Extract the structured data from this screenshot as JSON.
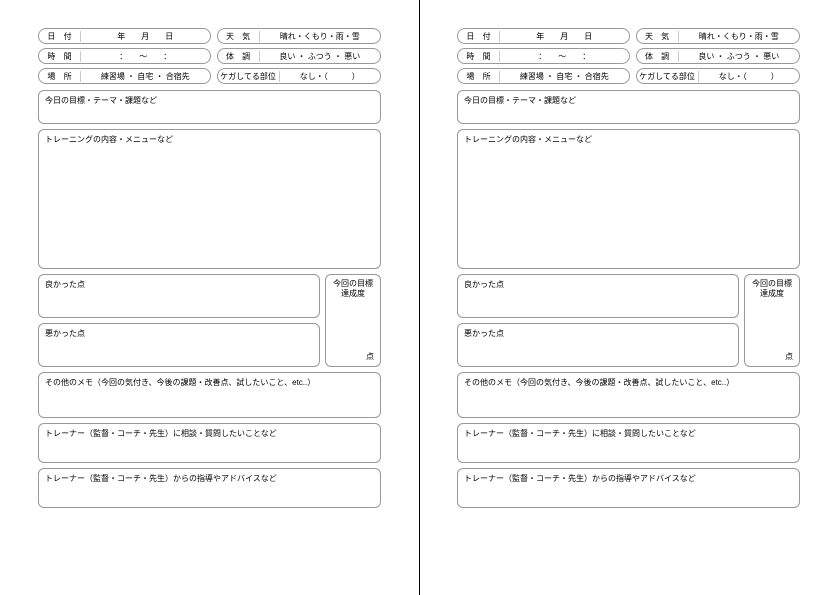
{
  "rows": {
    "date": {
      "lbl": "日 付",
      "val": "年　　月　　日"
    },
    "weather": {
      "lbl": "天 気",
      "val": "晴れ・くもり・雨・雪"
    },
    "time": {
      "lbl": "時 間",
      "val": "：　　～　　："
    },
    "cond": {
      "lbl": "体 調",
      "val": "良い ・ ふつう ・ 悪い"
    },
    "place": {
      "lbl": "場 所",
      "val": "練習場 ・ 自宅 ・  合宿先"
    },
    "injury": {
      "lbl": "ケガしてる部位",
      "val": "なし・（　　　）"
    }
  },
  "sections": {
    "goal": "今日の目標・テーマ・課題など",
    "train": "トレーニングの内容・メニューなど",
    "good": "良かった点",
    "bad": "悪かった点",
    "achTitle": "今回の目標\n達成度",
    "achPt": "点",
    "memo": "その他のメモ（今回の気付き、今後の課題・改善点、試したいこと、etc..）",
    "consult": "トレーナー（監督・コーチ・先生）に相談・質問したいことなど",
    "advice": "トレーナー（監督・コーチ・先生）からの指導やアドバイスなど"
  }
}
